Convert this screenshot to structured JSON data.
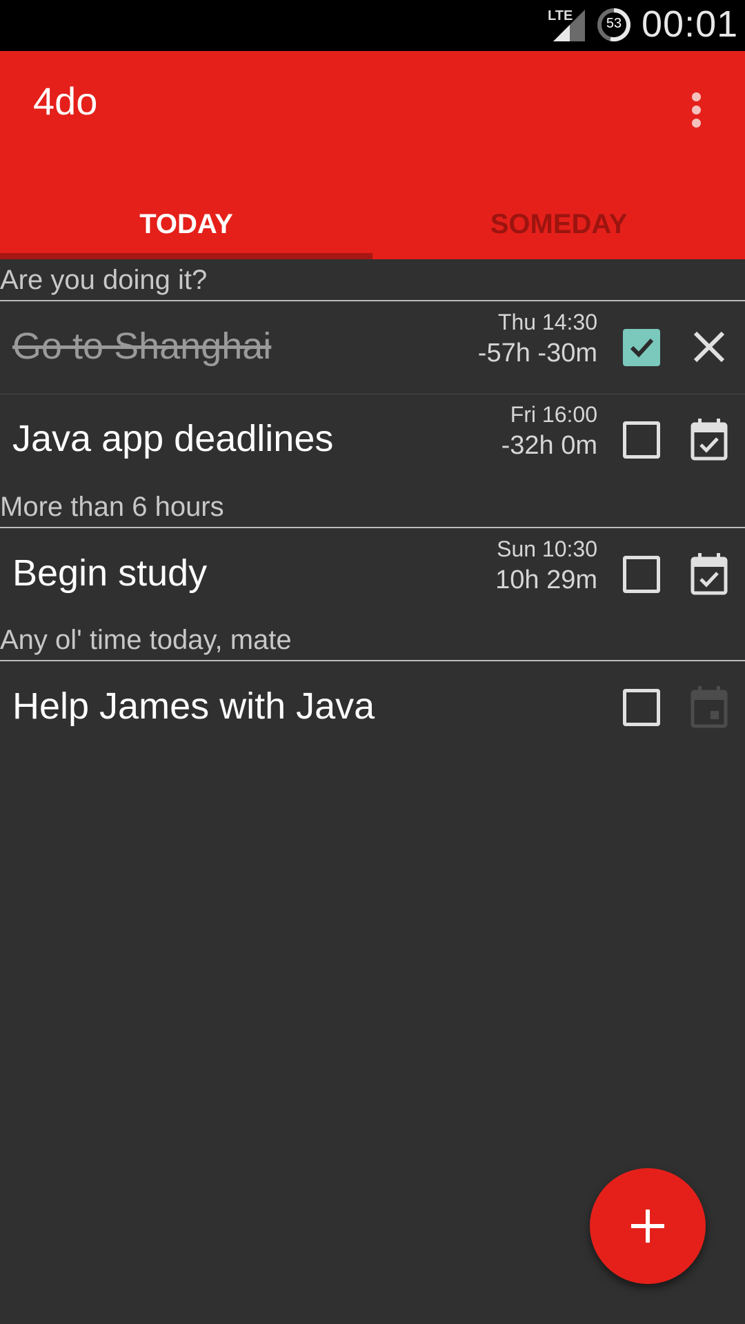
{
  "status_bar": {
    "network": "LTE",
    "battery": "53",
    "time": "00:01"
  },
  "app": {
    "title": "4do",
    "accent_color": "#e5201a",
    "menu_icon": "more-vert-icon"
  },
  "tabs": [
    {
      "label": "TODAY",
      "selected": true
    },
    {
      "label": "SOMEDAY",
      "selected": false
    }
  ],
  "sections": [
    {
      "header": "Are you doing it?",
      "tasks": [
        {
          "title": "Go to Shanghai",
          "day": "Thu 14:30",
          "delta": "-57h -30m",
          "done": true,
          "action_icon": "close-icon"
        },
        {
          "title": "Java app deadlines",
          "day": "Fri 16:00",
          "delta": "-32h 0m",
          "done": false,
          "action_icon": "event-available-icon"
        }
      ]
    },
    {
      "header": "More than 6 hours",
      "tasks": [
        {
          "title": "Begin study",
          "day": "Sun 10:30",
          "delta": "10h 29m",
          "done": false,
          "action_icon": "event-available-icon"
        }
      ]
    },
    {
      "header": "Any ol' time today, mate",
      "tasks": [
        {
          "title": "Help James with Java",
          "day": "",
          "delta": "",
          "done": false,
          "action_icon": "event-icon"
        }
      ]
    }
  ],
  "fab": {
    "icon": "add-icon"
  }
}
